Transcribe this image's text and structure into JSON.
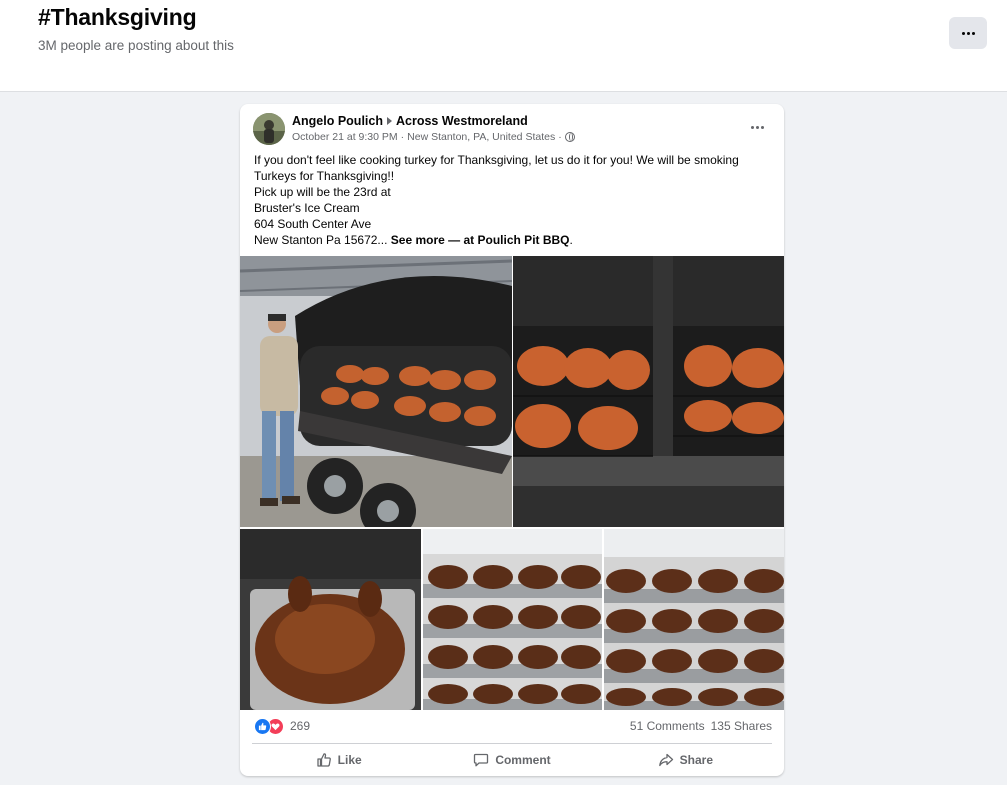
{
  "header": {
    "title": "#Thanksgiving",
    "subtitle": "3M people are posting about this",
    "more_icon": "more-horizontal-icon"
  },
  "post": {
    "author": "Angelo Poulich",
    "group": "Across Westmoreland",
    "timestamp": "October 21 at 9:30 PM",
    "location": "New Stanton, PA, United States",
    "privacy_icon": "globe-icon",
    "text_lines": [
      "If you don't feel like cooking turkey for Thanksgiving, let us do it for you!  We will be smoking",
      "Turkeys for Thanksgiving!!",
      "Pick up will be the 23rd at",
      "Bruster's Ice Cream",
      "604 South Center Ave"
    ],
    "last_line_prefix": "New Stanton Pa 15672...",
    "see_more": "See more",
    "at_text": "— at",
    "page_link": "Poulich Pit BBQ",
    "page_link_suffix": "."
  },
  "reactions": {
    "count": "269",
    "comments": "51 Comments",
    "shares": "135 Shares",
    "icons": [
      "like-reaction-icon",
      "love-reaction-icon"
    ]
  },
  "actions": {
    "like": "Like",
    "comment": "Comment",
    "share": "Share"
  },
  "colors": {
    "accent_blue": "#1877f2",
    "love_red": "#f33e58",
    "secondary_text": "#65676b",
    "background": "#f0f2f5"
  }
}
